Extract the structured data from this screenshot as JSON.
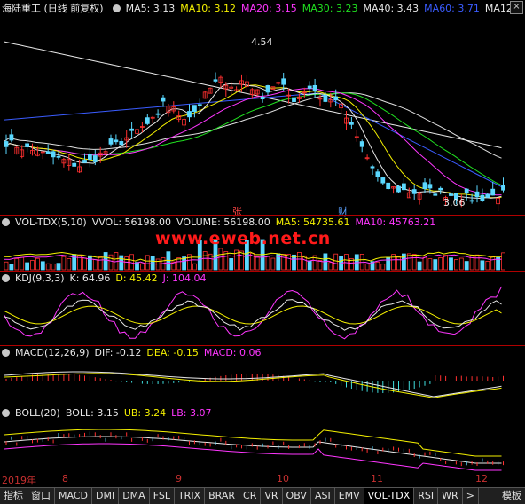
{
  "main": {
    "stock_title": "海陆重工 (日线 前复权)",
    "ma": [
      {
        "label": "MA5: 3.13",
        "color": "#e8e8e8"
      },
      {
        "label": "MA10: 3.12",
        "color": "#f4f000"
      },
      {
        "label": "MA20: 3.15",
        "color": "#ff36ff"
      },
      {
        "label": "MA30: 3.23",
        "color": "#20e020"
      },
      {
        "label": "MA40: 3.43",
        "color": "#e8e8e8"
      },
      {
        "label": "MA60: 3.71",
        "color": "#3a5cff"
      },
      {
        "label": "MA12",
        "color": "#e8e8e8"
      }
    ],
    "high_label": "4.54",
    "low_label": "3.06",
    "tag_zhang": "张",
    "tag_cai": "财",
    "close_glyph": "×"
  },
  "volume": {
    "title": "VOL-TDX(5,10)",
    "vvol": "VVOL: 56198.00",
    "volume": "VOLUME: 56198.00",
    "ma5": "MA5: 54735.61",
    "ma10": "MA10: 45763.21"
  },
  "watermark": "www.eweb.net.cn",
  "kdj": {
    "title": "KDJ(9,3,3)",
    "k": "K: 64.96",
    "d": "D: 45.42",
    "j": "J: 104.04"
  },
  "macd": {
    "title": "MACD(12,26,9)",
    "dif": "DIF: -0.12",
    "dea": "DEA: -0.15",
    "macd": "MACD: 0.06"
  },
  "boll": {
    "title": "BOLL(20)",
    "boll": "BOLL: 3.15",
    "ub": "UB: 3.24",
    "lb": "LB: 3.07"
  },
  "time_axis": [
    "2019年",
    "8",
    "9",
    "10",
    "11",
    "12"
  ],
  "tabs": [
    "指标",
    "窗口",
    "MACD",
    "DMI",
    "DMA",
    "FSL",
    "TRIX",
    "BRAR",
    "CR",
    "VR",
    "OBV",
    "ASI",
    "EMV",
    "VOL-TDX",
    "RSI",
    "WR",
    ">",
    "模板"
  ],
  "colors": {
    "up": "#ff3030",
    "down": "#5ad8ff",
    "background": "#000000",
    "divider": "#b00000"
  }
}
